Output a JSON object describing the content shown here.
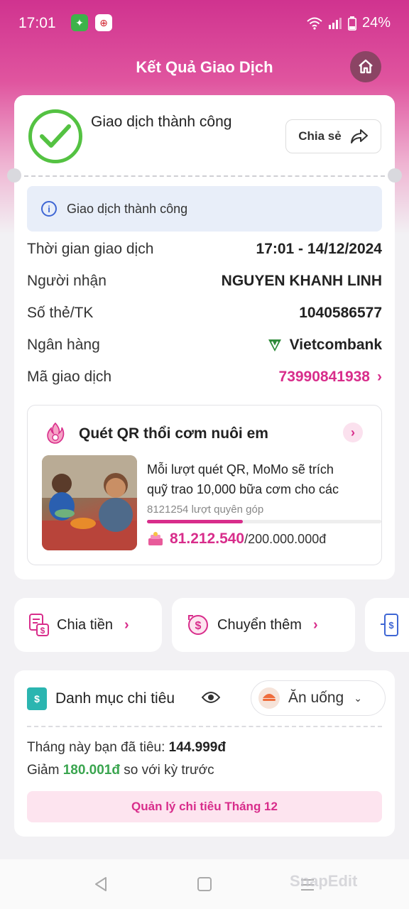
{
  "status_bar": {
    "time": "17:01",
    "battery": "24%"
  },
  "header": {
    "title": "Kết Quả Giao Dịch"
  },
  "result": {
    "status_title": "Giao dịch thành công",
    "share_label": "Chia sẻ",
    "info_message": "Giao dịch thành công",
    "details": {
      "time_label": "Thời gian giao dịch",
      "time_value": "17:01 - 14/12/2024",
      "recipient_label": "Người nhận",
      "recipient_value": "NGUYEN KHANH LINH",
      "account_label": "Số thẻ/TK",
      "account_value": "1040586577",
      "bank_label": "Ngân hàng",
      "bank_value": "Vietcombank",
      "txn_label": "Mã giao dịch",
      "txn_value": "73990841938"
    }
  },
  "campaign": {
    "title": "Quét QR thổi cơm nuôi em",
    "desc_line1": "Mỗi lượt quét QR, MoMo sẽ trích",
    "desc_line2": "quỹ trao 10,000 bữa cơm cho các",
    "donations": "8121254 lượt quyên góp",
    "progress_fraction": 0.41,
    "raised": "81.212.540",
    "goal": "/200.000.000đ"
  },
  "actions": {
    "split_label": "Chia tiền",
    "transfer_more_label": "Chuyển thêm"
  },
  "spending": {
    "title": "Danh mục chi tiêu",
    "category": "Ăn uống",
    "month_prefix": "Tháng này bạn đã tiêu: ",
    "month_amount": "144.999đ",
    "decrease_prefix": "Giảm ",
    "decrease_amount": "180.001đ",
    "decrease_suffix": " so với kỳ trước",
    "manage_label": "Quản lý chi tiêu Tháng 12"
  },
  "watermark": "SnapEdit",
  "colors": {
    "brand": "#d82d8b",
    "success": "#54c242",
    "info": "#3e66d4"
  }
}
